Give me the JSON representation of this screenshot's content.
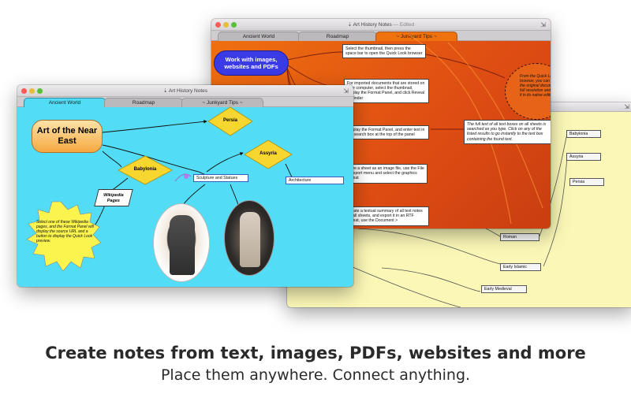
{
  "windows": {
    "back": {
      "title": "Art History Notes",
      "edited": "— Edited",
      "tabs": [
        "Ancient World",
        "Roadmap",
        "~ Junkyard Tips ~"
      ],
      "highlight": "Work with images, websites and PDFs",
      "notes": [
        "Select the thumbnail, then press the space bar to open the Quick Look browser",
        "For imported documents that are stored on your computer, select the thumbnail, display the Format Panel, and click Reveal in Finder",
        "Display the Format Panel, and enter text in the search box at the top of the panel",
        "Save a sheet as an image file, use the File > Export menu and select the graphics format",
        "Create a textual summary of all text notes on all sheets, and export it in an RTF format, use the Document >"
      ],
      "search_note": "The full text of all text boxes on all sheets is searched as you type. Click on any of the listed results to go instantly to the text box containing the found text.",
      "oval_note": "From the Quick Look browser, you can see the original document in full resolution and open it in its native editor"
    },
    "right": {
      "items": [
        "Babylonia",
        "Assyria",
        "Persia",
        "Roman",
        "Early Islamic",
        "Early Medieval"
      ]
    },
    "front": {
      "title": "Art History Notes",
      "tabs": [
        "Ancient World",
        "Roadmap",
        "~ Junkyard Tips ~"
      ],
      "main_topic": "Art of the Near East",
      "diamonds": [
        "Persia",
        "Assyria",
        "Babylonia"
      ],
      "boxes": [
        "Sculpture and Statues",
        "Architecture"
      ],
      "parallelogram": "Wikipedia Pages",
      "star_note": "Select one of these Wikipedia pages, and the Format Panel will display the source URL and a button to display the Quick Look preview."
    }
  },
  "tagline": {
    "headline": "Create notes from text, images, PDFs, websites and more",
    "subline": "Place them anywhere. Connect anything."
  },
  "colors": {
    "front_canvas": "#52dcf5",
    "back_canvas": "#e85d12",
    "right_canvas": "#fbf8b7",
    "topic_fill": "#fcc774",
    "diamond_fill": "#f8d630",
    "highlight_fill": "#3b3be6"
  }
}
